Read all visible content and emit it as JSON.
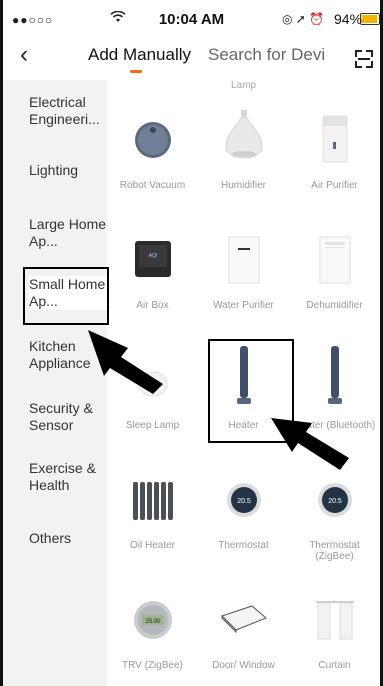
{
  "status_bar": {
    "signal": "●●○○○",
    "wifi": "WiFi",
    "time": "10:04 AM",
    "icons": "◎ ➚ ⏰",
    "battery": "94%",
    "battery_level": 0.94
  },
  "header": {
    "back_icon": "chevron-left-icon",
    "active_tab": "Add Manually",
    "inactive_tab": "Search for Devi",
    "scan_icon": "scan-icon"
  },
  "sidebar": {
    "items": [
      {
        "label": "Electrical Engineeri..."
      },
      {
        "label": "Lighting"
      },
      {
        "label": "Large Home Ap..."
      },
      {
        "label": "Small Home Ap..."
      },
      {
        "label": "Kitchen Appliance"
      },
      {
        "label": "Security & Sensor"
      },
      {
        "label": "Exercise & Health"
      },
      {
        "label": "Others"
      }
    ]
  },
  "grid": {
    "cropped_top_label": "Lamp",
    "devices": [
      {
        "label": "Robot Vacuum",
        "icon": "robot-vacuum-icon"
      },
      {
        "label": "Humidifier",
        "icon": "humidifier-icon"
      },
      {
        "label": "Air Purifier",
        "icon": "air-purifier-icon"
      },
      {
        "label": "Air Box",
        "icon": "air-box-icon"
      },
      {
        "label": "Water Purifier",
        "icon": "water-purifier-icon"
      },
      {
        "label": "Dehumidifier",
        "icon": "dehumidifier-icon"
      },
      {
        "label": "Sleep Lamp",
        "icon": "sleep-lamp-icon"
      },
      {
        "label": "Heater",
        "icon": "heater-icon"
      },
      {
        "label": "Heater (Bluetooth)",
        "icon": "heater-icon"
      },
      {
        "label": "Oil Heater",
        "icon": "oil-heater-icon"
      },
      {
        "label": "Thermostat",
        "icon": "thermostat-icon"
      },
      {
        "label": "Thermostat (ZigBee)",
        "icon": "thermostat-icon"
      },
      {
        "label": "TRV (ZigBee)",
        "icon": "trv-icon"
      },
      {
        "label": "Door/ Window",
        "icon": "door-window-sensor-icon"
      },
      {
        "label": "Curtain",
        "icon": "curtain-icon"
      }
    ],
    "thermostat_reading": "20.5",
    "trv_reading": "25.00"
  }
}
